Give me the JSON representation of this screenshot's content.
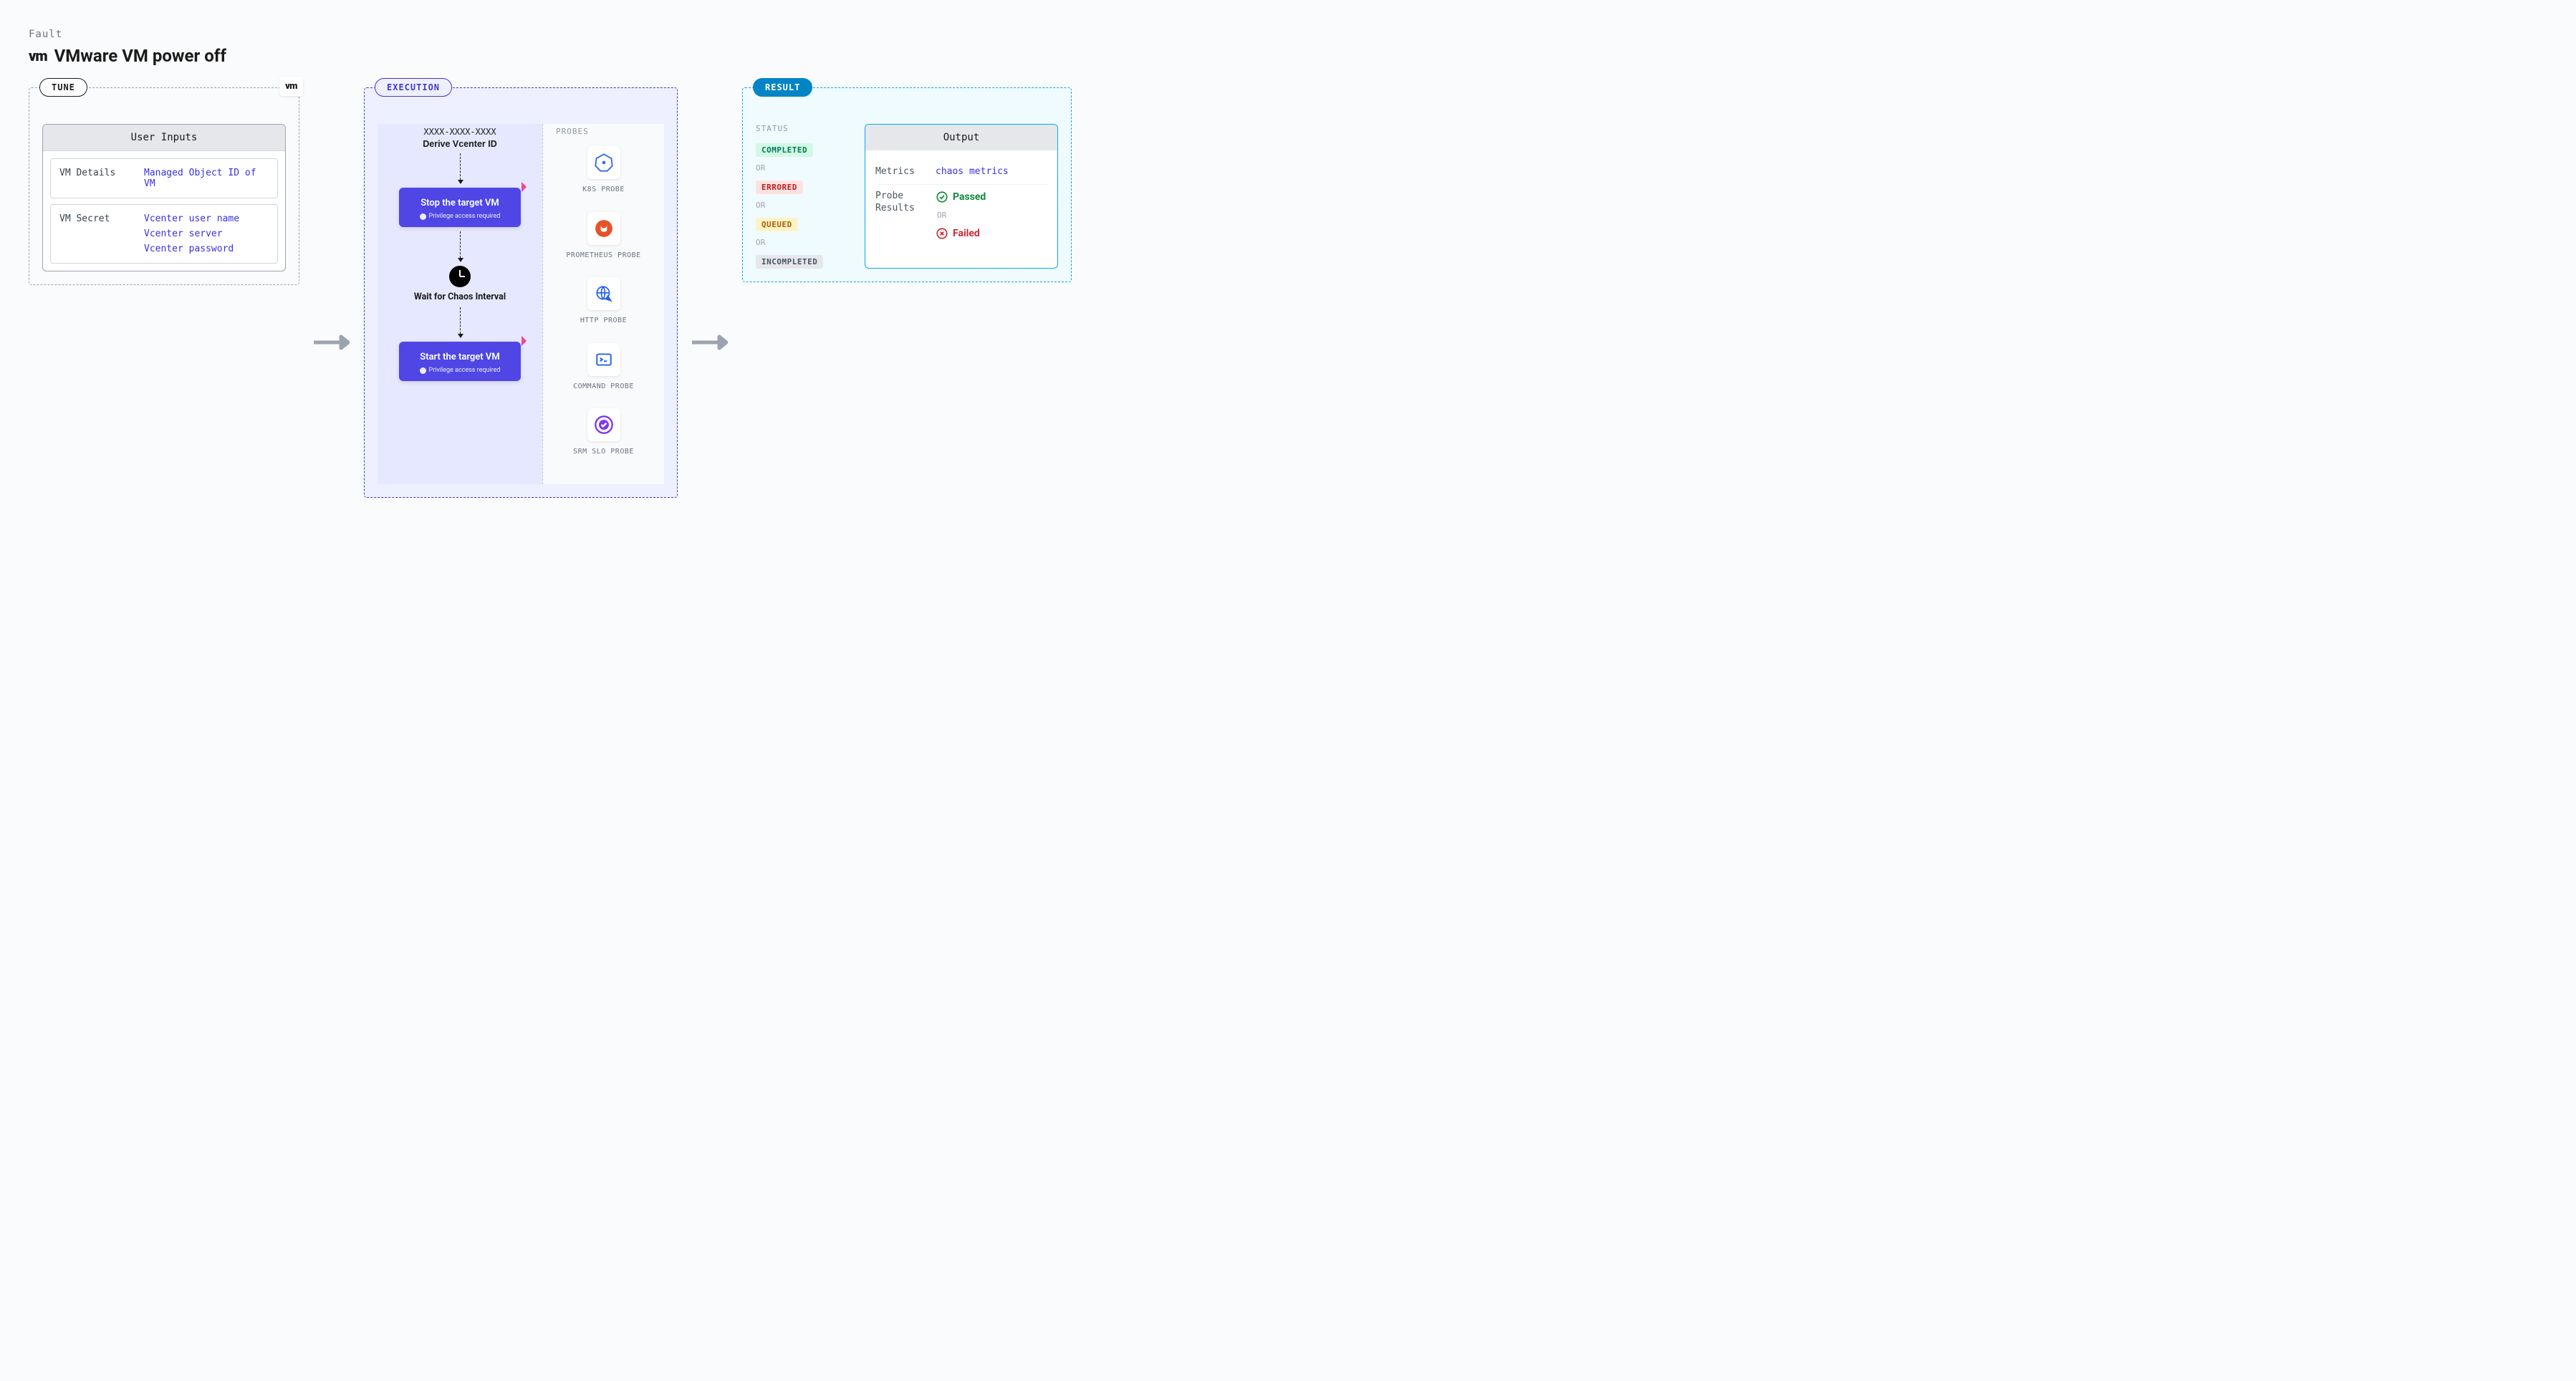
{
  "header": {
    "category": "Fault",
    "title": "VMware VM power off",
    "logo": "vm"
  },
  "tune": {
    "tag": "TUNE",
    "badge": "vm",
    "table_title": "User Inputs",
    "rows": [
      {
        "k": "VM Details",
        "v": [
          "Managed Object ID of VM"
        ]
      },
      {
        "k": "VM Secret",
        "v": [
          "Vcenter user name",
          "Vcenter server",
          "Vcenter password"
        ]
      }
    ]
  },
  "execution": {
    "tag": "EXECUTION",
    "derive_id": "XXXX-XXXX-XXXX",
    "derive_label": "Derive Vcenter ID",
    "steps": {
      "stop": {
        "title": "Stop the target VM",
        "priv": "Privilege access required"
      },
      "wait": {
        "label": "Wait for Chaos Interval"
      },
      "start": {
        "title": "Start the target VM",
        "priv": "Privilege access required"
      }
    },
    "probes_label": "PROBES",
    "probes": [
      {
        "name": "k8s",
        "label": "K8S PROBE"
      },
      {
        "name": "prometheus",
        "label": "PROMETHEUS PROBE"
      },
      {
        "name": "http",
        "label": "HTTP PROBE"
      },
      {
        "name": "command",
        "label": "COMMAND PROBE"
      },
      {
        "name": "srm",
        "label": "SRM SLO PROBE"
      }
    ]
  },
  "result": {
    "tag": "RESULT",
    "status_label": "STATUS",
    "or": "OR",
    "statuses": {
      "completed": "COMPLETED",
      "errored": "ERRORED",
      "queued": "QUEUED",
      "incompleted": "INCOMPLETED"
    },
    "output": {
      "title": "Output",
      "metrics_k": "Metrics",
      "metrics_v": "chaos metrics",
      "probe_results_k": "Probe Results",
      "passed": "Passed",
      "failed": "Failed"
    }
  }
}
